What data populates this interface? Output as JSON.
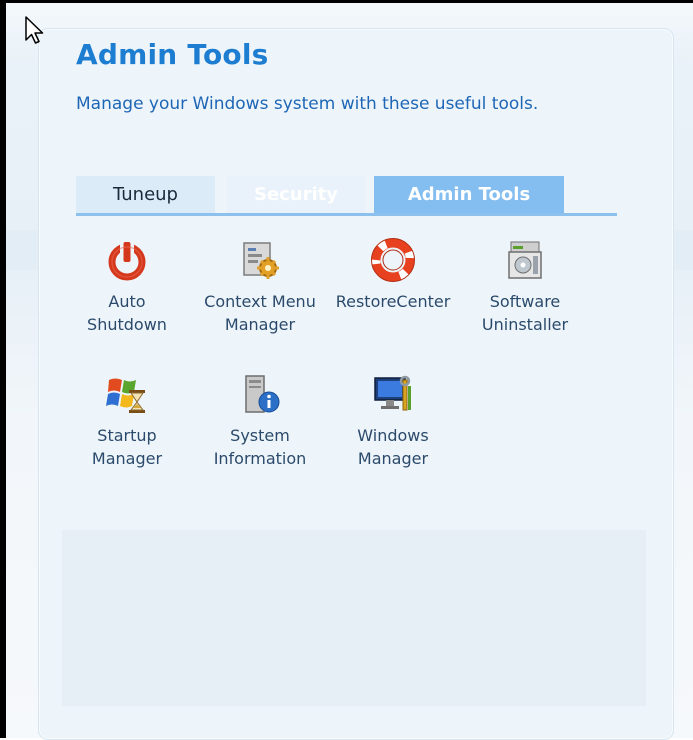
{
  "header": {
    "title": "Admin Tools",
    "subtitle": "Manage your Windows system with these useful tools."
  },
  "tabs": [
    {
      "label": "Tuneup",
      "state": "inactive"
    },
    {
      "label": "Security",
      "state": "inactive-faded"
    },
    {
      "label": "Admin Tools",
      "state": "active"
    }
  ],
  "tools": [
    {
      "icon": "power-icon",
      "line1": "Auto",
      "line2": "Shutdown"
    },
    {
      "icon": "context-menu-gear-icon",
      "line1": "Context Menu",
      "line2": "Manager"
    },
    {
      "icon": "lifebuoy-icon",
      "line1": "RestoreCenter",
      "line2": ""
    },
    {
      "icon": "software-box-icon",
      "line1": "Software",
      "line2": "Uninstaller"
    },
    {
      "icon": "windows-hourglass-icon",
      "line1": "Startup",
      "line2": "Manager"
    },
    {
      "icon": "computer-info-icon",
      "line1": "System",
      "line2": "Information"
    },
    {
      "icon": "monitor-tools-icon",
      "line1": "Windows",
      "line2": "Manager"
    }
  ],
  "colors": {
    "title": "#1d7dd1",
    "active_tab": "#84bdef",
    "label": "#2b4a6b"
  }
}
